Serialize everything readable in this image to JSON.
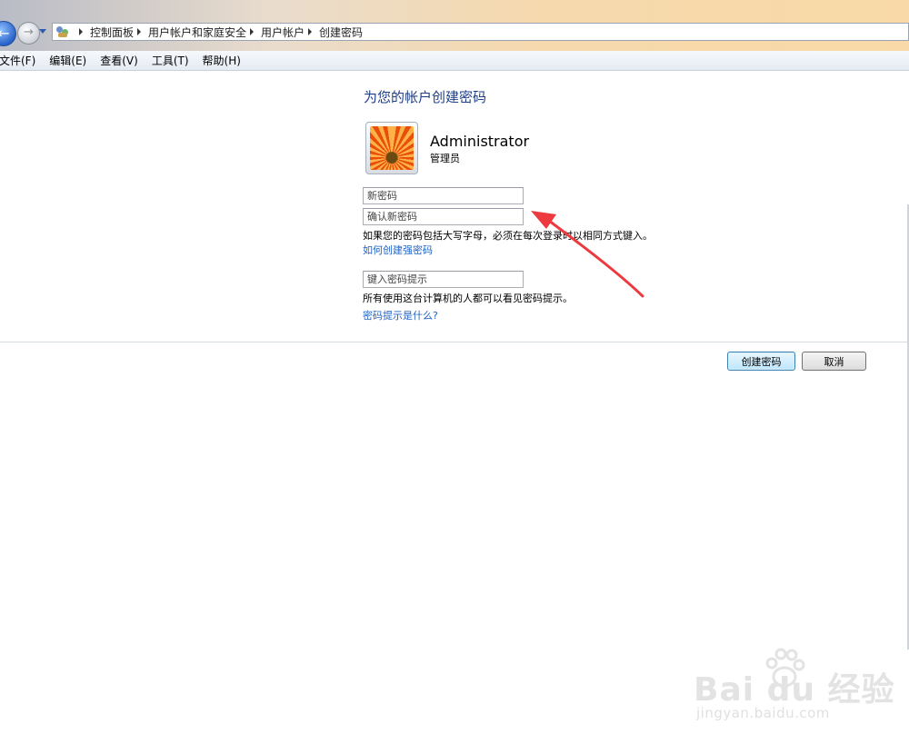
{
  "breadcrumbs": [
    "控制面板",
    "用户帐户和家庭安全",
    "用户帐户",
    "创建密码"
  ],
  "menu": [
    "文件(F)",
    "编辑(E)",
    "查看(V)",
    "工具(T)",
    "帮助(H)"
  ],
  "page": {
    "heading": "为您的帐户创建密码",
    "user": {
      "name": "Administrator",
      "type": "管理员"
    },
    "new_password": {
      "value": "",
      "placeholder": "新密码"
    },
    "confirm_password": {
      "value": "",
      "placeholder": "确认新密码"
    },
    "uppercase_note": "如果您的密码包括大写字母，必须在每次登录时以相同方式键入。",
    "strong_password_link": "如何创建强密码",
    "hint": {
      "value": "",
      "placeholder": "键入密码提示"
    },
    "hint_note": "所有使用这台计算机的人都可以看见密码提示。",
    "hint_link": "密码提示是什么?"
  },
  "buttons": {
    "create": "创建密码",
    "cancel": "取消"
  },
  "watermark": {
    "logo": "Bai du 经验",
    "url": "jingyan.baidu.com"
  },
  "colors": {
    "heading": "#1e3f87",
    "link": "#1f63c6",
    "annotation_arrow": "#ec3a3f"
  },
  "icons": [
    "back-arrow-icon",
    "forward-arrow-icon",
    "dropdown-icon",
    "control-panel-icon",
    "user-avatar-flower",
    "red-arrow-annotation",
    "paw-icon"
  ]
}
